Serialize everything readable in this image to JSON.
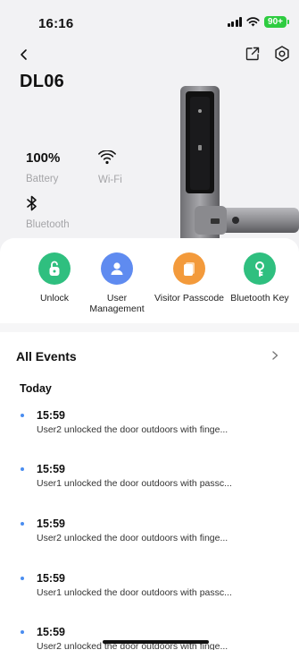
{
  "status_bar": {
    "time": "16:16",
    "battery": "90+",
    "battery_color": "#2ecc40"
  },
  "header": {
    "device_name": "DL06",
    "back_icon": "chevron-left-icon",
    "share_icon": "external-link-icon",
    "settings_icon": "gear-icon"
  },
  "device_status": {
    "battery_value": "100%",
    "battery_label": "Battery",
    "wifi_label": "Wi-Fi",
    "bluetooth_label": "Bluetooth"
  },
  "actions": [
    {
      "label": "Unlock",
      "icon": "unlock-icon",
      "color": "#2fbf7f"
    },
    {
      "label": "User Management",
      "icon": "user-icon",
      "color": "#5f8bf0"
    },
    {
      "label": "Visitor Passcode",
      "icon": "passcode-card-icon",
      "color": "#f39a3b"
    },
    {
      "label": "Bluetooth Key",
      "icon": "key-icon",
      "color": "#2fbf7f"
    }
  ],
  "events": {
    "title": "All Events",
    "group_label": "Today",
    "dot_color": "#4a8df0",
    "items": [
      {
        "time": "15:59",
        "text": "User2 unlocked the door outdoors with finge..."
      },
      {
        "time": "15:59",
        "text": "User1 unlocked the door outdoors with passc..."
      },
      {
        "time": "15:59",
        "text": "User2 unlocked the door outdoors with finge..."
      },
      {
        "time": "15:59",
        "text": "User1 unlocked the door outdoors with passc..."
      },
      {
        "time": "15:59",
        "text": "User2 unlocked the door outdoors with finge..."
      }
    ]
  }
}
